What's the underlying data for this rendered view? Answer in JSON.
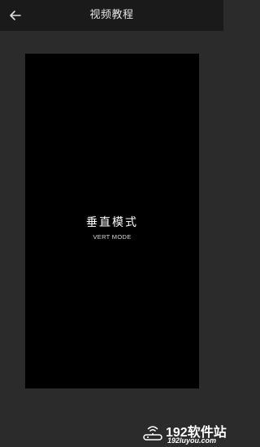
{
  "header": {
    "title": "视频教程",
    "back_icon": "arrow-left-icon"
  },
  "video": {
    "mode_title": "垂直模式",
    "mode_subtitle": "VERT MODE"
  },
  "watermark": {
    "main": "192软件站",
    "sub": "192luyou.com",
    "icon": "wifi-router-icon"
  },
  "colors": {
    "background": "#2b2b2b",
    "header": "#1a1a1a",
    "video_panel": "#000000"
  }
}
